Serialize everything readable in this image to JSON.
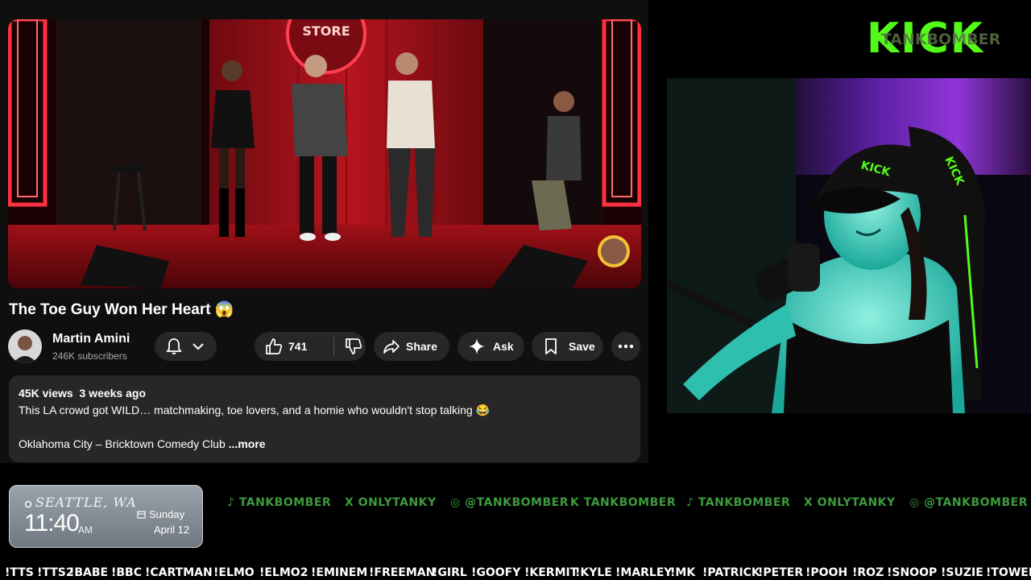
{
  "video": {
    "title": "The Toe Guy Won Her Heart 😱",
    "channel_name": "Martin Amini",
    "channel_subs": "246K subscribers",
    "like_count": "741",
    "share_label": "Share",
    "ask_label": "Ask",
    "save_label": "Save",
    "views": "45K views",
    "age": "3 weeks ago",
    "description_line1": "This LA crowd got WILD… matchmaking, toe lovers, and a homie who wouldn't stop talking 😂",
    "description_line2": "Oklahoma City – Bricktown Comedy Club",
    "more_label": "...more",
    "stage_sign": "STORE"
  },
  "overlay": {
    "kick_logo": "KICK",
    "streamer_tag": "TANKBOMBER",
    "cap_text": "KICK",
    "chair_text": "KICK",
    "clock": {
      "location": "SEATTLE, WA",
      "time": "11:40",
      "ampm": "AM",
      "day": "Sunday",
      "date": "April 12"
    },
    "socials": [
      {
        "icon": "tiktok-icon",
        "handle": "TANKBOMBER",
        "glyph": "♪"
      },
      {
        "icon": "x-icon",
        "handle": "ONLYTANKY",
        "glyph": "X"
      },
      {
        "icon": "instagram-icon",
        "handle": "@TANKBOMBER",
        "glyph": "◎"
      },
      {
        "icon": "kick-icon",
        "handle": "TANKBOMBER",
        "glyph": "K"
      },
      {
        "icon": "tiktok-icon",
        "handle": "TANKBOMBER",
        "glyph": "♪"
      },
      {
        "icon": "x-icon",
        "handle": "ONLYTANKY",
        "glyph": "X"
      },
      {
        "icon": "instagram-icon",
        "handle": "@TANKBOMBER",
        "glyph": "◎"
      }
    ],
    "commands": [
      "!TTS",
      "!TTS2",
      "!BABE",
      "!BBC",
      "!CARTMAN",
      "!ELMO",
      "!ELMO2",
      "!EMINEM",
      "!FREEMAN",
      "!GIRL",
      "!GOOFY",
      "!KERMIT",
      "!KYLE",
      "!MARLEY",
      "!MK",
      "!PATRICK",
      "!PETER",
      "!POOH",
      "!ROZ",
      "!SNOOP",
      "!SUZIE",
      "!TOWEL"
    ]
  },
  "colors": {
    "kick_green": "#53fc18",
    "yt_bg": "#0f0f0f",
    "pill_bg": "#272727",
    "stage_red": "#a3121a"
  }
}
